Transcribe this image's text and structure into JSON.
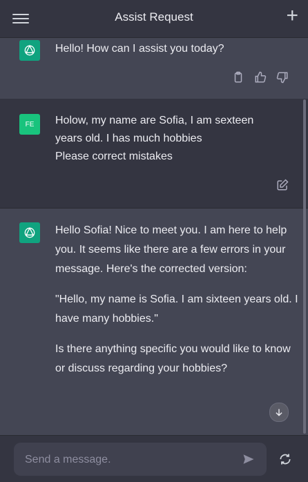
{
  "header": {
    "title": "Assist Request"
  },
  "messages": [
    {
      "role": "assistant",
      "text": "Hello! How can I assist you today?"
    },
    {
      "role": "user",
      "initials": "FE",
      "lines": [
        "Holow, my name are Sofia, I am sexteen",
        "years old. I has much hobbies",
        "Please correct mistakes"
      ]
    },
    {
      "role": "assistant",
      "paragraphs": [
        "Hello Sofia! Nice to meet you. I am here to help you. It seems like there are a few errors in your message. Here's the corrected version:",
        "\"Hello, my name is Sofia. I am sixteen years old. I have many hobbies.\"",
        "Is there anything specific you would like to know or discuss regarding your hobbies?"
      ]
    }
  ],
  "composer": {
    "placeholder": "Send a message."
  },
  "icons": {
    "menu": "hamburger-icon",
    "new_chat": "plus-icon",
    "copy": "clipboard-icon",
    "like": "thumbs-up-icon",
    "dislike": "thumbs-down-icon",
    "edit": "edit-icon",
    "send": "send-icon",
    "regenerate": "refresh-icon",
    "scroll": "arrow-down-icon"
  },
  "colors": {
    "background": "#343541",
    "assistant_bg": "#444654",
    "accent": "#10a37f",
    "user_avatar": "#19c37d"
  }
}
